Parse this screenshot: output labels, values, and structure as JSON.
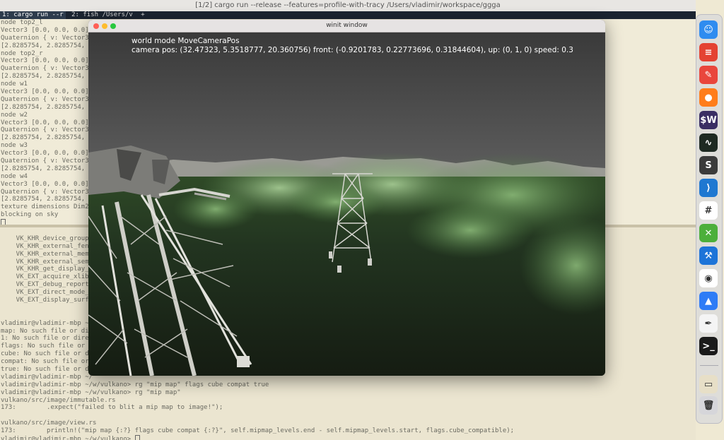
{
  "terminal": {
    "title": "[1/2] cargo run --release --features=profile-with-tracy /Users/vladimir/workspace/ggga",
    "tabs": [
      {
        "label": "1: cargo run --r"
      },
      {
        "label": "2: fish /Users/v"
      },
      {
        "label": "+"
      }
    ],
    "top_lines": [
      "node top2_l",
      "Vector3 [0.0, 0.0, 0.0]",
      "Quaternion { v: Vector3",
      "[2.8285754, 2.8285754, 2",
      "node top2_r",
      "Vector3 [0.0, 0.0, 0.0]",
      "Quaternion { v: Vector3",
      "[2.8285754, 2.8285754, 2",
      "node w1",
      "Vector3 [0.0, 0.0, 0.0]",
      "Quaternion { v: Vector3",
      "[2.8285754, 2.8285754, 2",
      "node w2",
      "Vector3 [0.0, 0.0, 0.0]",
      "Quaternion { v: Vector3",
      "[2.8285754, 2.8285754, 2",
      "node w3",
      "Vector3 [0.0, 0.0, 0.0]",
      "Quaternion { v: Vector3",
      "[2.8285754, 2.8285754, 2",
      "node w4",
      "Vector3 [0.0, 0.0, 0.0]",
      "Quaternion { v: Vector3",
      "[2.8285754, 2.8285754, 2",
      "texture dimensions Dim2d",
      "blocking on sky"
    ],
    "bottom_lines": [
      "",
      "    VK_KHR_device_group_",
      "    VK_KHR_external_fenc",
      "    VK_KHR_external_memo",
      "    VK_KHR_external_sema",
      "    VK_KHR_get_display_p",
      "    VK_EXT_acquire_xlib_",
      "    VK_EXT_debug_report",
      "    VK_EXT_direct_mode_d",
      "    VK_EXT_display_surfa",
      "",
      "",
      "vladimir@vladimir-mbp ~/",
      "map: No such file or dir",
      "1: No such file or direc",
      "flags: No such file or d",
      "cube: No such file or di",
      "compat: No such file or",
      "true: No such file or di",
      "vladimir@vladimir-mbp ~/",
      "vladimir@vladimir-mbp ~/w/vulkano> rg \"mip map\" flags cube compat true",
      "vladimir@vladimir-mbp ~/w/vulkano> rg \"mip map\"",
      "vulkano/src/image/immutable.rs",
      "173:        .expect(\"failed to blit a mip map to image!\");",
      "",
      "vulkano/src/image/view.rs",
      "173:        println!(\"mip map {:?} flags cube compat {:?}\", self.mipmap_levels.end - self.mipmap_levels.start, flags.cube_compatible);",
      "vladimir@vladimir-mbp ~/w/vulkano> "
    ]
  },
  "game_window": {
    "title": "winit window",
    "hud_line1": "world mode MoveCameraPos",
    "hud_line2": "camera pos: (32.47323, 5.3518777, 20.360756) front: (-0.9201783, 0.22773696, 0.31844604), up: (0, 1, 0) speed: 0.3"
  },
  "dock": {
    "apps": [
      {
        "name": "finder-icon",
        "glyph": "☺",
        "color": "#2f8cf0"
      },
      {
        "name": "todoist-icon",
        "glyph": "≡",
        "color": "#e44232"
      },
      {
        "name": "bear-icon",
        "glyph": "✎",
        "color": "#e9463c"
      },
      {
        "name": "firefox-icon",
        "glyph": "●",
        "color": "#ff7d1a"
      },
      {
        "name": "sw-icon",
        "glyph": "$W",
        "color": "#3a2e63"
      },
      {
        "name": "activity-monitor-icon",
        "glyph": "∿",
        "color": "#1e2a22"
      },
      {
        "name": "sublime-icon",
        "glyph": "S",
        "color": "#3b3b3b"
      },
      {
        "name": "vscode-icon",
        "glyph": "⟩",
        "color": "#1f78d1"
      },
      {
        "name": "slack-icon",
        "glyph": "#",
        "color": "#ffffff"
      },
      {
        "name": "xcode-tools-icon",
        "glyph": "✕",
        "color": "#4caf3a"
      },
      {
        "name": "xcode-icon",
        "glyph": "⚒",
        "color": "#1d74d8"
      },
      {
        "name": "chrome-icon",
        "glyph": "◉",
        "color": "#ffffff"
      },
      {
        "name": "maps-icon",
        "glyph": "▲",
        "color": "#2e7cf6"
      },
      {
        "name": "textedit-icon",
        "glyph": "✒",
        "color": "#f4f4f4"
      },
      {
        "name": "terminal-icon",
        "glyph": ">_",
        "color": "#1a1a1a"
      },
      {
        "name": "preview-icon",
        "glyph": "▭",
        "color": "#e7dfc7"
      },
      {
        "name": "trash-icon",
        "glyph": "🗑",
        "color": "#d6d6da"
      }
    ]
  },
  "colors": {
    "terminal_bg": "#efe9d3",
    "sky_top": "#3b3b3b",
    "cloud_green": "#7fa872",
    "ground_dark": "#1e2819"
  }
}
